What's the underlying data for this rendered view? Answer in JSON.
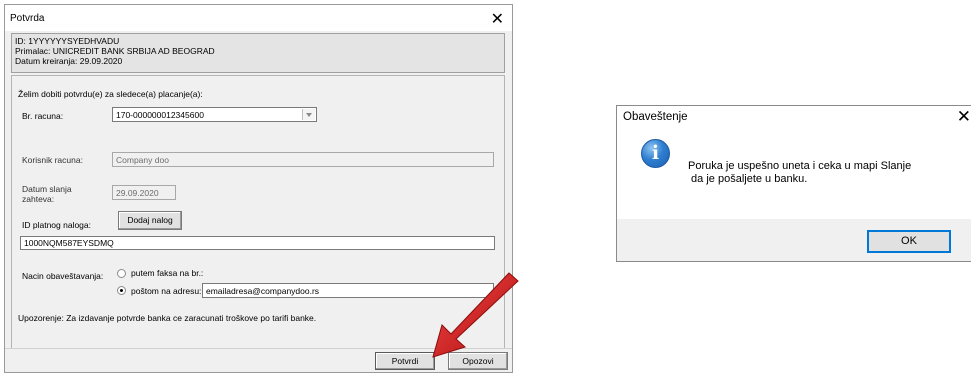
{
  "confirm_dialog": {
    "title": "Potvrda",
    "info": {
      "id_line": "ID: 1YYYYYYSYEDHVADU",
      "recipient_line": "Primalac: UNICREDIT BANK SRBIJA AD BEOGRAD",
      "created_line": "Datum kreiranja: 29.09.2020"
    },
    "intro_text": "Želim dobiti potvrdu(e) za sledece(a) placanje(a):",
    "account_label": "Br. racuna:",
    "account_value": "170-000000012345600",
    "user_label": "Korisnik racuna:",
    "user_value": "Company doo",
    "date_label_line1": "Datum slanja",
    "date_label_line2": "zahteva:",
    "date_value": "29.09.2020",
    "order_id_label": "ID platnog naloga:",
    "add_order_button": "Dodaj nalog",
    "order_id_value": "1000NQM587EYSDMQ",
    "notify_label": "Nacin obaveštavanja:",
    "fax_option": "putem faksa na br.:",
    "mail_option": "poštom na adresu:",
    "mail_value": "emailadresa@companydoo.rs",
    "notify_selected": "mail",
    "warning_text": "Upozorenje: Za izdavanje potvrde banka ce zaracunati troškove po tarifi banke.",
    "confirm_button": "Potvrdi",
    "cancel_button": "Opozovi"
  },
  "notice_dialog": {
    "title": "Obaveštenje",
    "message_line1": "Poruka je uspešno uneta i ceka u mapi Slanje",
    "message_line2": " da je pošaljete u banku.",
    "ok_button": "OK",
    "icon": "info-icon"
  },
  "colors": {
    "dialog_bg": "#f0f0f0",
    "arrow_red": "#d7191c",
    "focus_blue": "#0078d7"
  }
}
